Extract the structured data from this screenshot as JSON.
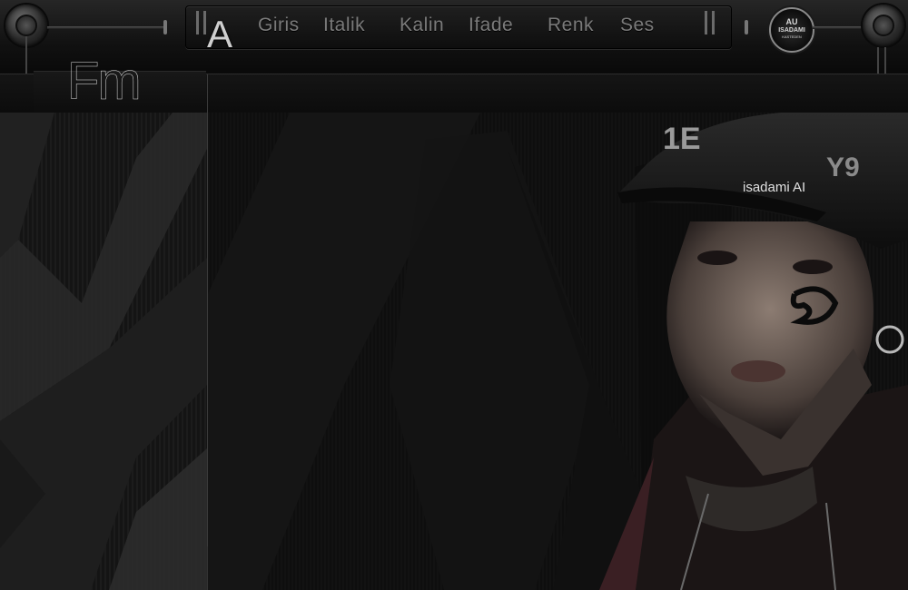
{
  "header": {
    "logo_letter": "A",
    "nav": [
      {
        "label": "Giris"
      },
      {
        "label": "Italik"
      },
      {
        "label": "Kalin"
      },
      {
        "label": "Ifade"
      },
      {
        "label": "Renk"
      },
      {
        "label": "Ses"
      }
    ],
    "badge": {
      "line1": "AU",
      "line2": "ISADAMI",
      "line3": "KASTEDEN"
    }
  },
  "section": {
    "title": "Fm"
  },
  "image": {
    "signature": "isadami AI"
  },
  "colors": {
    "background": "#0b0b0b",
    "nav_text": "#7a7a7a",
    "accent_gray": "#bdbdbd"
  }
}
